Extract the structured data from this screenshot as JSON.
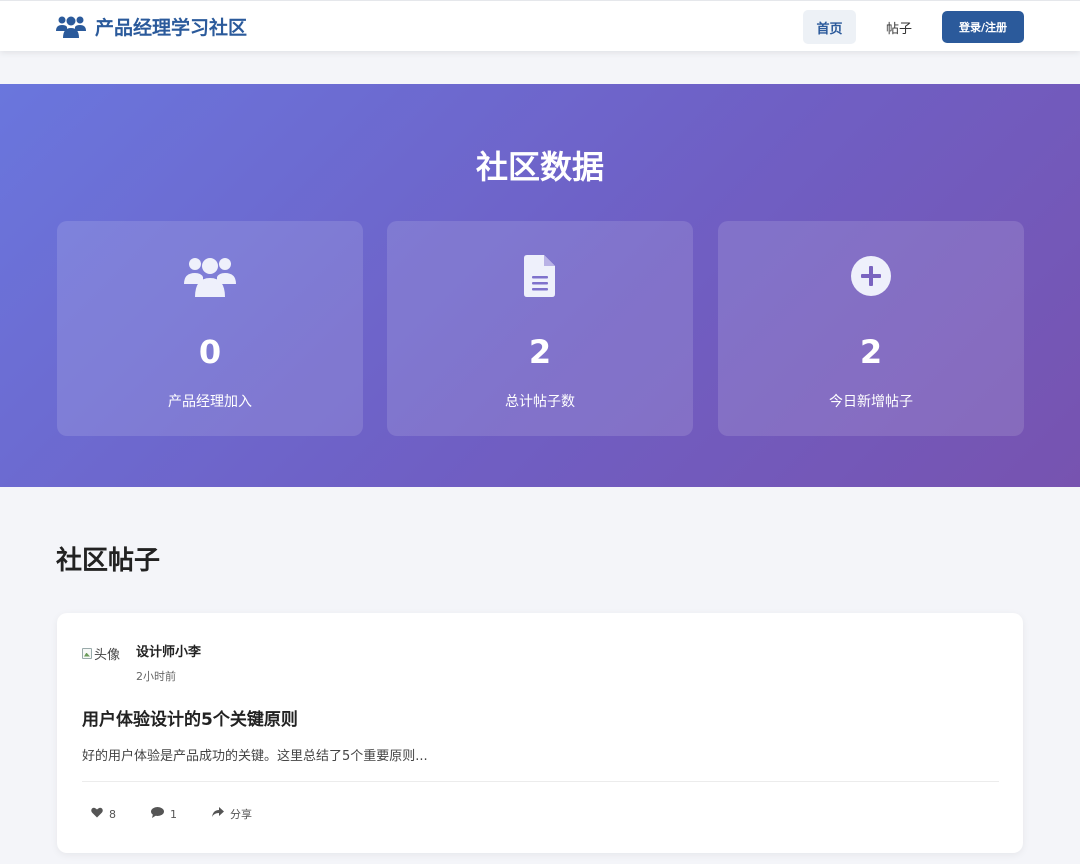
{
  "header": {
    "brand": "产品经理学习社区",
    "brand_icon": "users-icon",
    "nav": {
      "home": "首页",
      "posts": "帖子",
      "login": "登录/注册"
    },
    "colors": {
      "primary": "#2b5a9b"
    }
  },
  "stats": {
    "title": "社区数据",
    "cards": [
      {
        "icon": "users-icon",
        "value": "0",
        "label": "产品经理加入"
      },
      {
        "icon": "document-icon",
        "value": "2",
        "label": "总计帖子数"
      },
      {
        "icon": "plus-circle-icon",
        "value": "2",
        "label": "今日新增帖子"
      }
    ],
    "gradient": [
      "#6a76dd",
      "#7753b0"
    ]
  },
  "posts_section": {
    "title": "社区帖子",
    "posts": [
      {
        "avatar_alt": "头像",
        "author": "设计师小李",
        "time": "2小时前",
        "title": "用户体验设计的5个关键原则",
        "excerpt": "好的用户体验是产品成功的关键。这里总结了5个重要原则...",
        "likes": "8",
        "comments": "1",
        "share_label": "分享"
      }
    ]
  }
}
